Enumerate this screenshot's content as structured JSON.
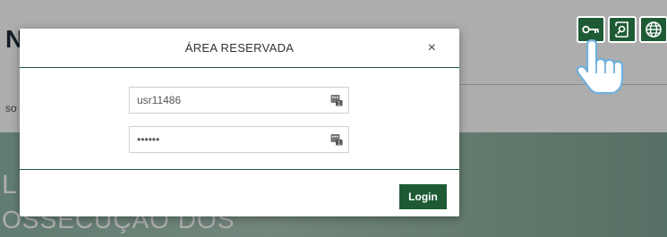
{
  "background": {
    "logo_letter": "N",
    "sub_text": "so",
    "banner_line1": "L",
    "banner_line2": "OSSECUÇÃO DOS"
  },
  "top_icons": [
    "key-icon",
    "search-document-icon",
    "globe-icon"
  ],
  "modal": {
    "title": "ÁREA RESERVADA",
    "close": "×",
    "username_value": "usr11486",
    "password_value": "••••••",
    "login_label": "Login"
  },
  "colors": {
    "accent": "#1e5b35",
    "banner": "#a9c6b7"
  }
}
